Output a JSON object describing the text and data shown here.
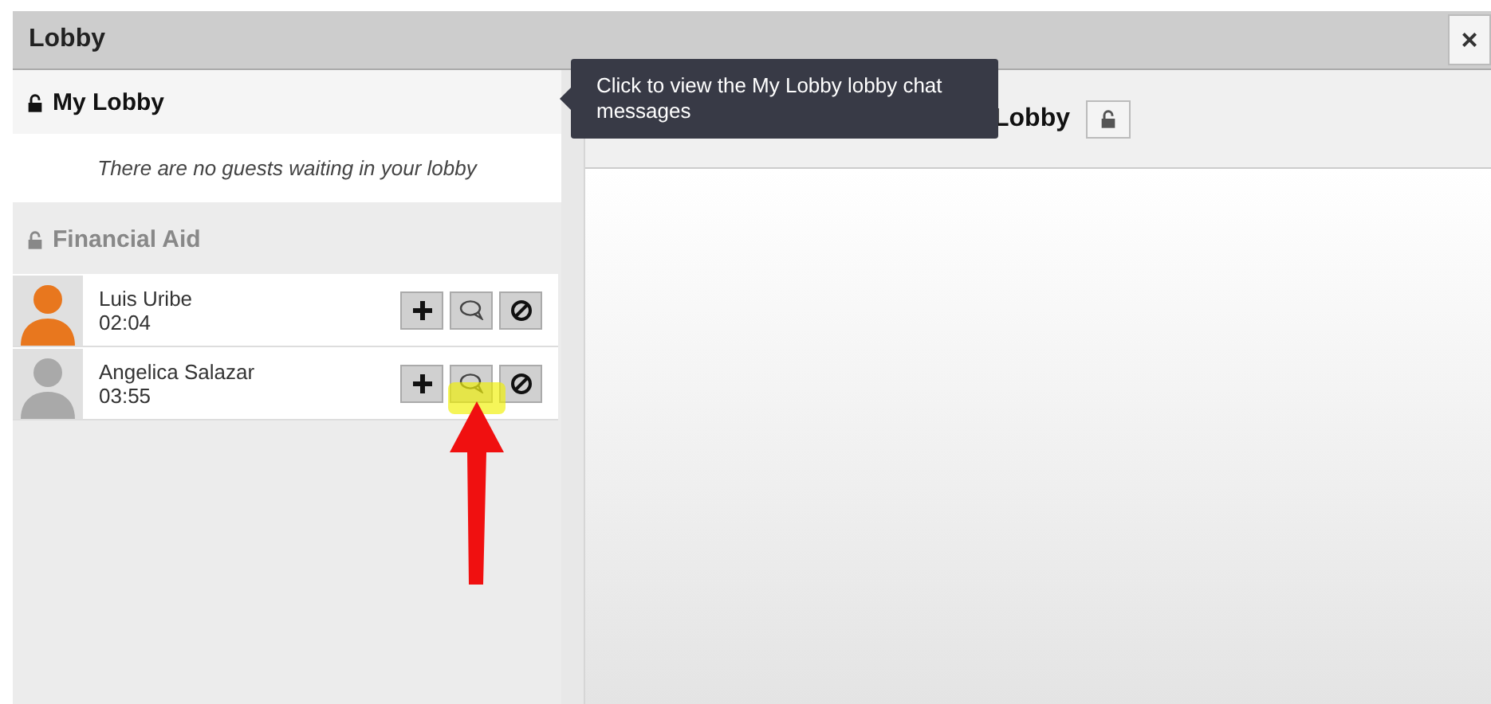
{
  "window": {
    "title": "Lobby",
    "close_label": "×"
  },
  "lobbies": [
    {
      "name": "My Lobby",
      "locked": false,
      "selected": true,
      "empty_message": "There are no guests waiting in your lobby"
    },
    {
      "name": "Financial Aid",
      "locked": false,
      "selected": false,
      "guests": [
        {
          "name": "Luis Uribe",
          "time": "02:04",
          "color": "#e8771e"
        },
        {
          "name": "Angelica Salazar",
          "time": "03:55",
          "color": "#a9a9a9"
        }
      ]
    }
  ],
  "tooltip": {
    "text": "Click to view the My Lobby lobby chat messages"
  },
  "chat_header": {
    "title": "Lobby",
    "locked": false
  },
  "annotations": [
    {
      "kind": "highlight"
    },
    {
      "kind": "arrow"
    }
  ]
}
